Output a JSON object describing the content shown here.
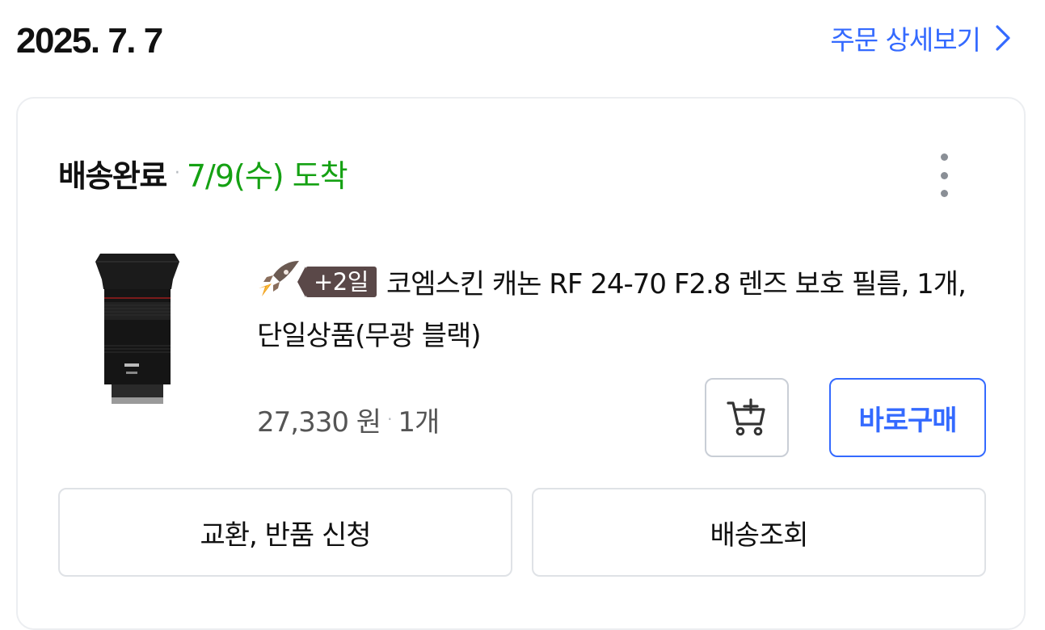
{
  "order": {
    "date": "2025. 7. 7",
    "detail_link_label": "주문 상세보기"
  },
  "delivery": {
    "status": "배송완료",
    "arrival": "7/9(수) 도착"
  },
  "product": {
    "delivery_badge": "+2일",
    "name": "코엠스킨 캐논 RF 24-70 F2.8 렌즈 보호 필름, 1개, 단일상품(무광 블랙)",
    "price": "27,330 원",
    "quantity": "1개",
    "image_alt": "canon-rf-lens-photo",
    "rocket_icon": "rocket-icon"
  },
  "actions": {
    "buy_now_label": "바로구매",
    "add_to_cart_icon": "add-to-cart-icon",
    "return_label": "교환, 반품 신청",
    "track_label": "배송조회"
  },
  "colors": {
    "accent": "#346aff",
    "arrival_green": "#15a113",
    "badge_bg": "#5a4848"
  }
}
